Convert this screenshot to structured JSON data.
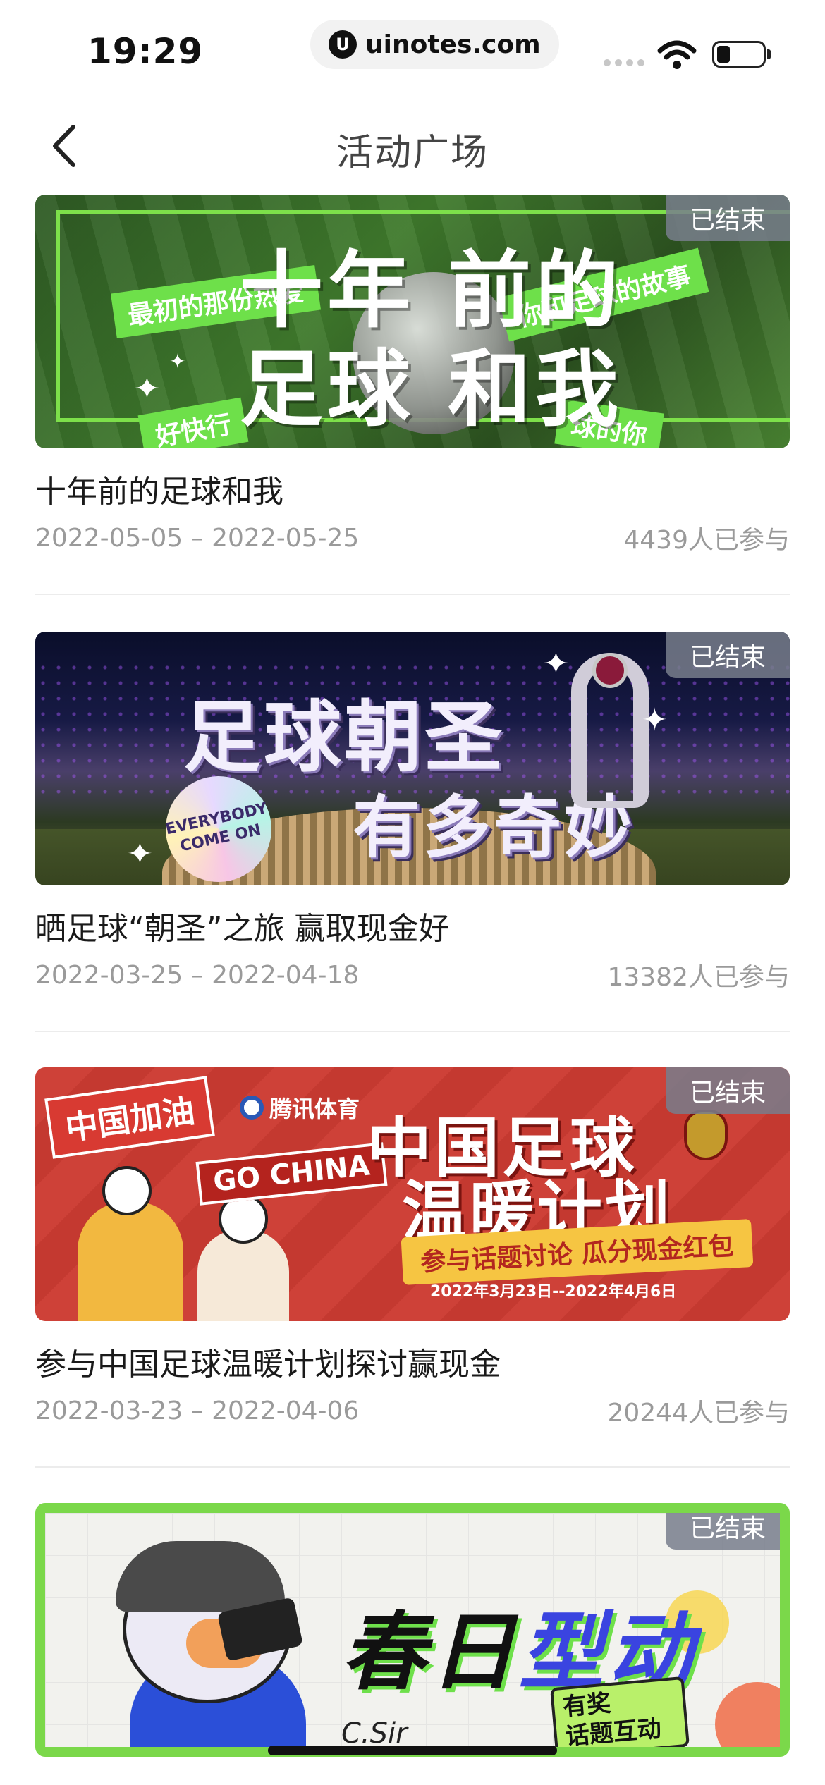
{
  "status_bar": {
    "time": "19:29",
    "url": "uinotes.com",
    "url_icon_glyph": "U"
  },
  "nav": {
    "title": "活动广场",
    "back_icon": "chevron-left-icon"
  },
  "badge_ended": "已结束",
  "activities": [
    {
      "title": "十年前的足球和我",
      "date_range": "2022-05-05 – 2022-05-25",
      "participants": "4439人已参与",
      "status": "已结束",
      "banner": {
        "line1": "十年 前的",
        "line2": "足球 和我",
        "tag_left": "最初的那份热爱",
        "tag_right": "你和足球的故事",
        "tag_bottom_left": "好快行",
        "tag_bottom_right": "球的你"
      }
    },
    {
      "title": "晒足球“朝圣”之旅 赢取现金好",
      "date_range": "2022-03-25 – 2022-04-18",
      "participants": "13382人已参与",
      "status": "已结束",
      "banner": {
        "line1": "足球朝圣",
        "line2": "有多奇妙",
        "seal_line1": "EVERYBODY",
        "seal_line2": "COME ON"
      }
    },
    {
      "title": "参与中国足球温暖计划探讨赢现金",
      "date_range": "2022-03-23 – 2022-04-06",
      "participants": "20244人已参与",
      "status": "已结束",
      "banner": {
        "flag": "中国加油",
        "go_china": "GO CHINA",
        "brand": "腾讯体育",
        "line1": "中国足球",
        "line2": "温暖计划",
        "slogan": "参与话题讨论  瓜分现金红包",
        "dates": "2022年3月23日--2022年4月6日"
      }
    },
    {
      "title": "春日型动",
      "status": "已结束",
      "banner": {
        "line1_a": "春日",
        "line1_b": "型动",
        "prize_line1": "有奖",
        "prize_line2": "话题互动",
        "signature": "C.Sir"
      }
    }
  ],
  "colors": {
    "accent_green": "#6ee04a",
    "badge_gray": "#787e8c",
    "meta_gray": "#9a9a9a"
  }
}
